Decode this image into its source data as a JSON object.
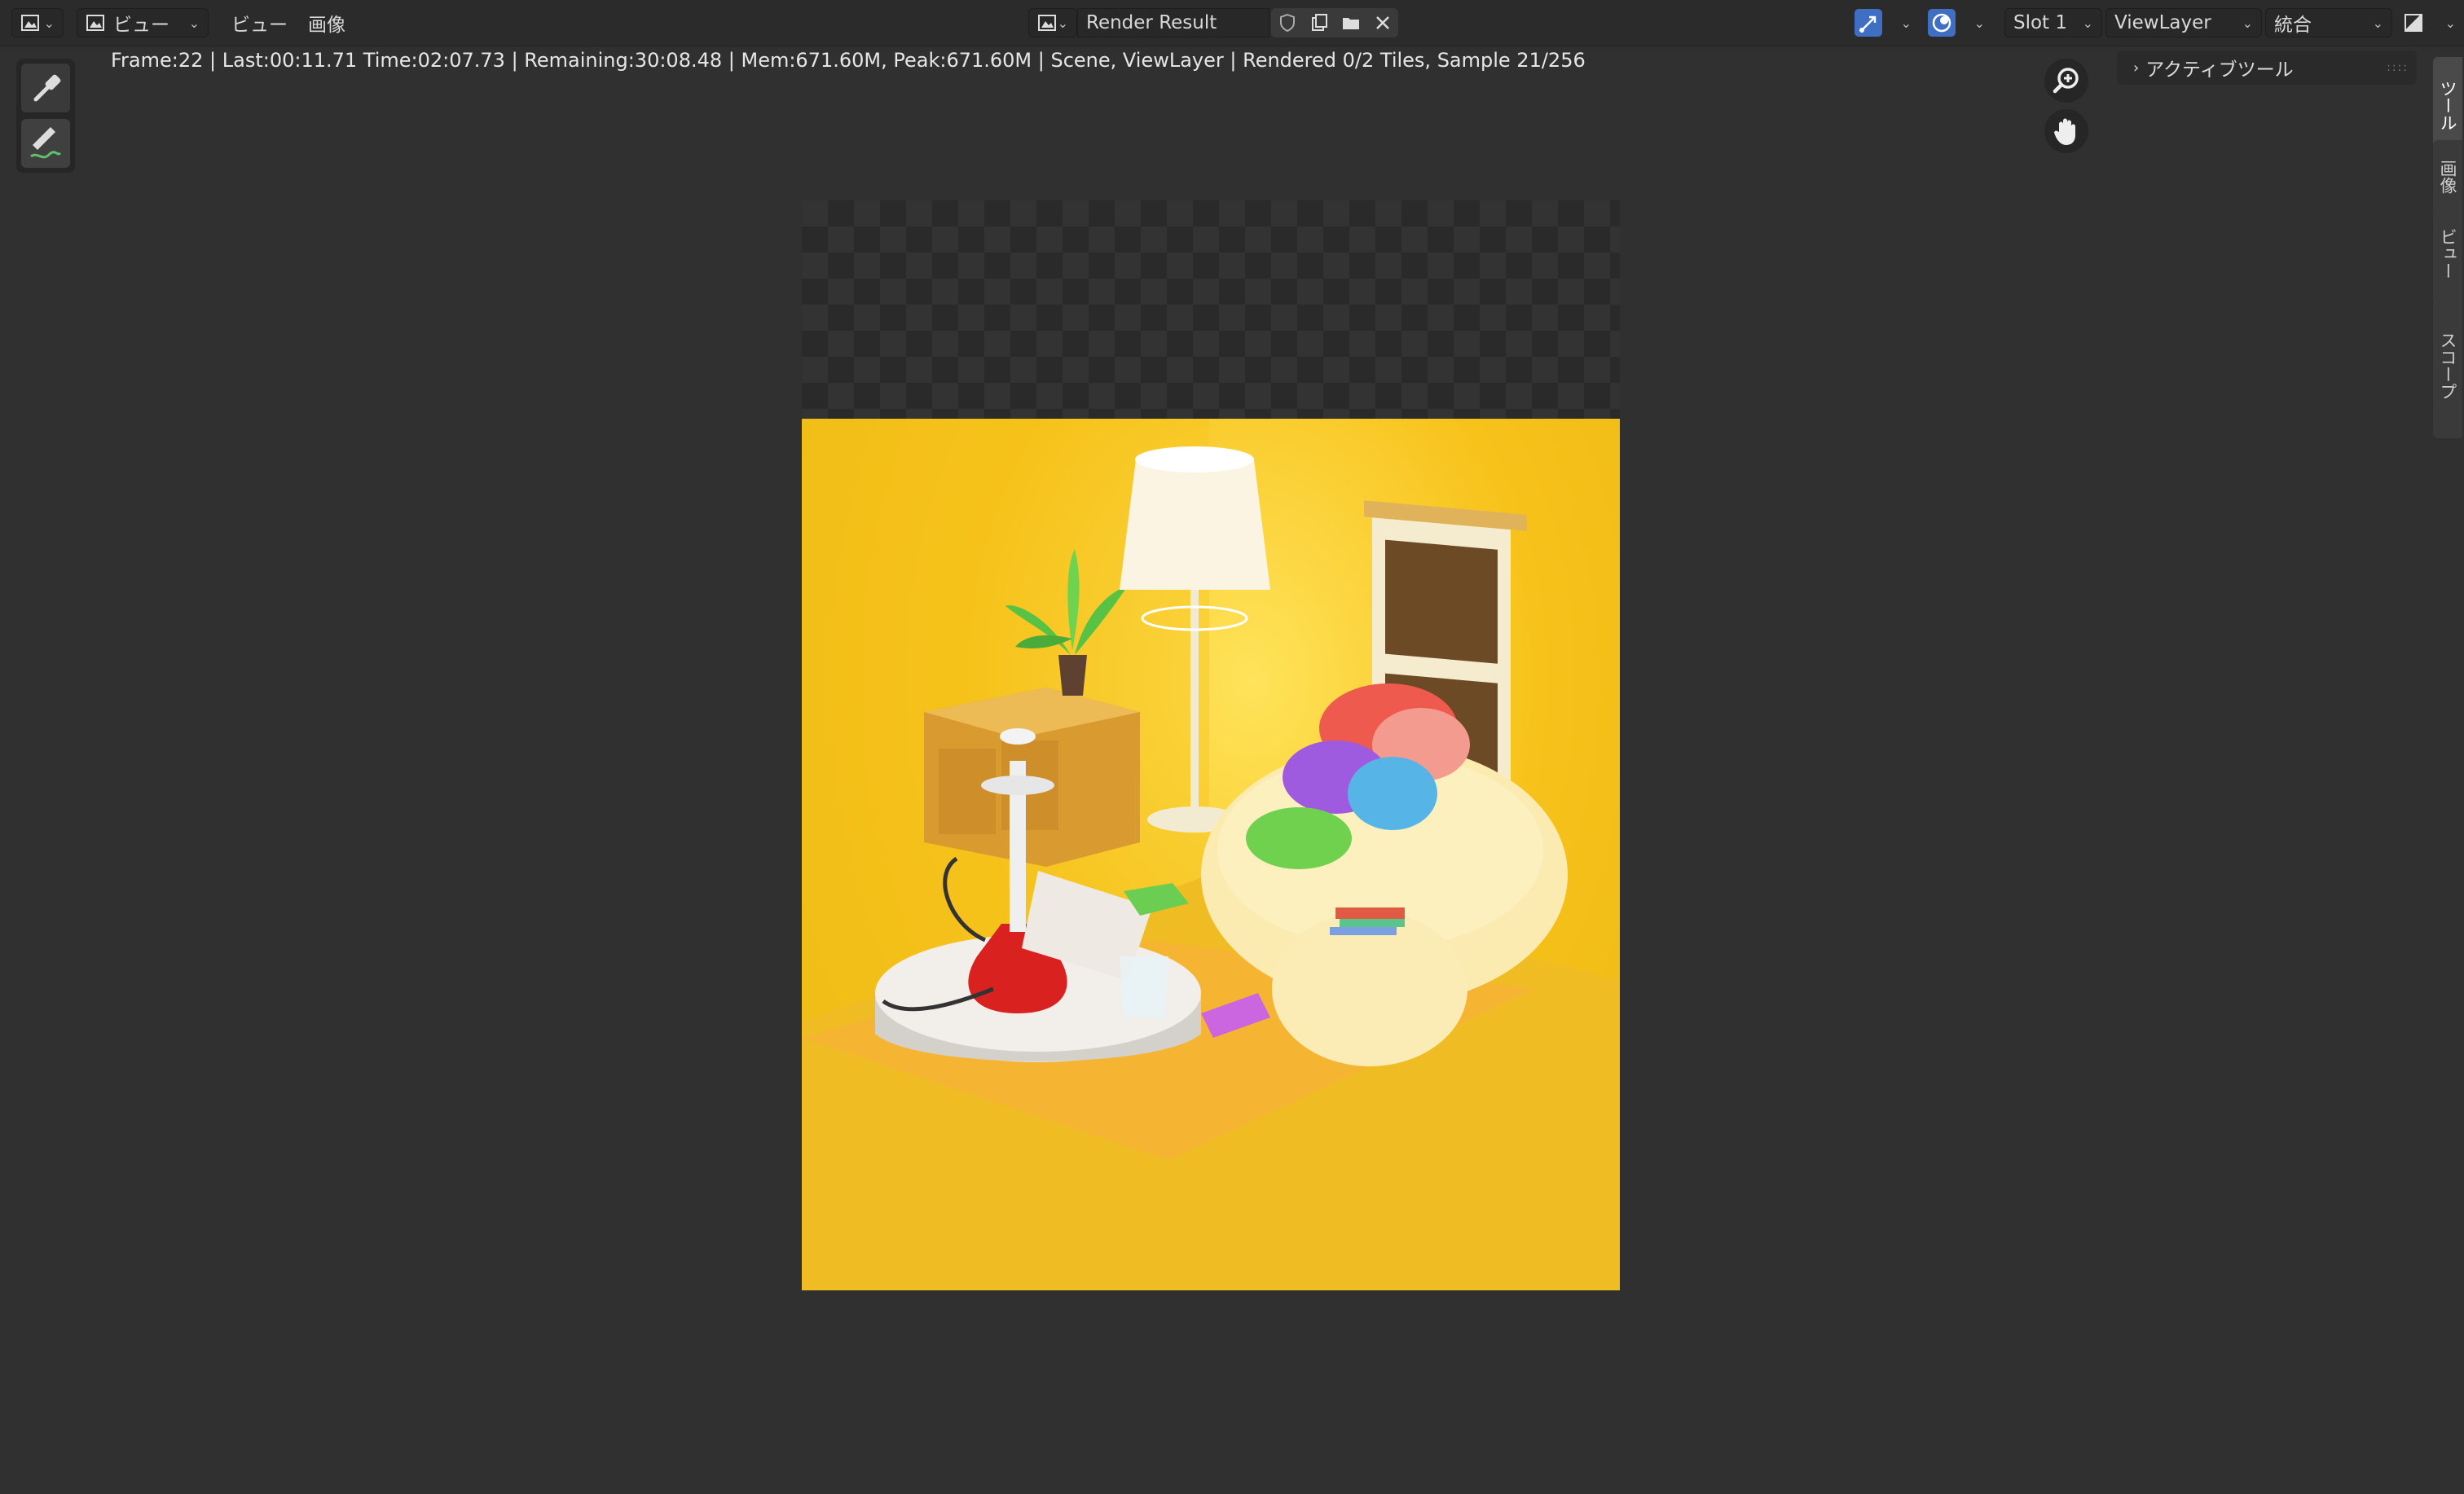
{
  "header": {
    "view_menu_1": "ビュー",
    "view_menu_2": "ビュー",
    "image_menu": "画像",
    "image_name": "Render Result",
    "slot": "Slot 1",
    "view_layer": "ViewLayer",
    "pass": "統合"
  },
  "status": {
    "text": "Frame:22 | Last:00:11.71 Time:02:07.73 | Remaining:30:08.48 | Mem:671.60M, Peak:671.60M | Scene, ViewLayer | Rendered 0/2 Tiles, Sample 21/256"
  },
  "sidebar": {
    "panel_title": "アクティブツール",
    "tabs": [
      "ツール",
      "画像",
      "ビュー",
      "スコープ"
    ]
  },
  "colors": {
    "background": "#303030",
    "accent": "#3f6fc2",
    "render_yellow": "#f7c21a"
  },
  "icons": {
    "editor_type": "image-editor-icon",
    "sample_tool": "eyedropper-icon",
    "annotate_tool": "annotate-pencil-icon",
    "zoom": "zoom-icon",
    "pan": "hand-icon"
  }
}
